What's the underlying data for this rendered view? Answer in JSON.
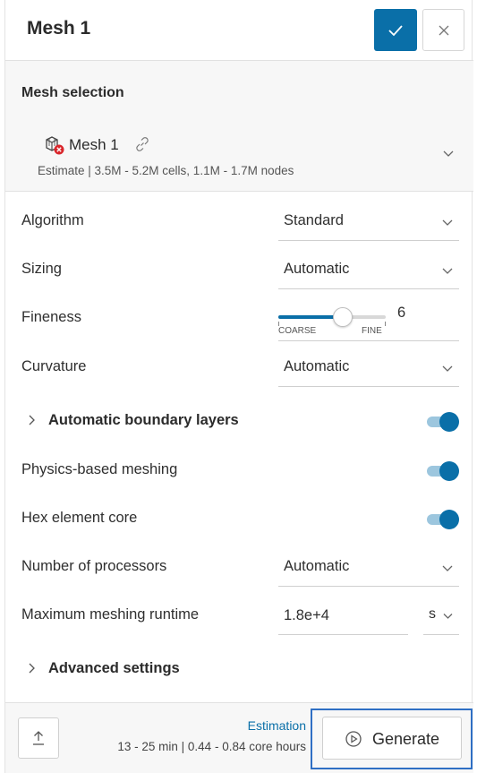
{
  "header": {
    "title": "Mesh 1"
  },
  "mesh_selection": {
    "label": "Mesh selection",
    "mesh_name": "Mesh 1",
    "estimate": "Estimate | 3.5M - 5.2M cells, 1.1M - 1.7M nodes"
  },
  "settings": {
    "algorithm": {
      "label": "Algorithm",
      "value": "Standard"
    },
    "sizing": {
      "label": "Sizing",
      "value": "Automatic"
    },
    "fineness": {
      "label": "Fineness",
      "value": "6",
      "min_label": "COARSE",
      "max_label": "FINE",
      "level_fraction": 0.6
    },
    "curvature": {
      "label": "Curvature",
      "value": "Automatic"
    },
    "boundary_layers": {
      "label": "Automatic boundary layers",
      "enabled": true
    },
    "physics_meshing": {
      "label": "Physics-based meshing",
      "enabled": true
    },
    "hex_core": {
      "label": "Hex element core",
      "enabled": true
    },
    "processors": {
      "label": "Number of processors",
      "value": "Automatic"
    },
    "runtime": {
      "label": "Maximum meshing runtime",
      "value": "1.8e+4",
      "unit": "s"
    },
    "advanced": {
      "label": "Advanced settings"
    }
  },
  "footer": {
    "estimation_label": "Estimation",
    "estimation_text": "13 - 25 min | 0.44 - 0.84 core hours",
    "generate_label": "Generate"
  },
  "colors": {
    "accent": "#0a6fa8",
    "highlight_outline": "#2f6fc4"
  }
}
